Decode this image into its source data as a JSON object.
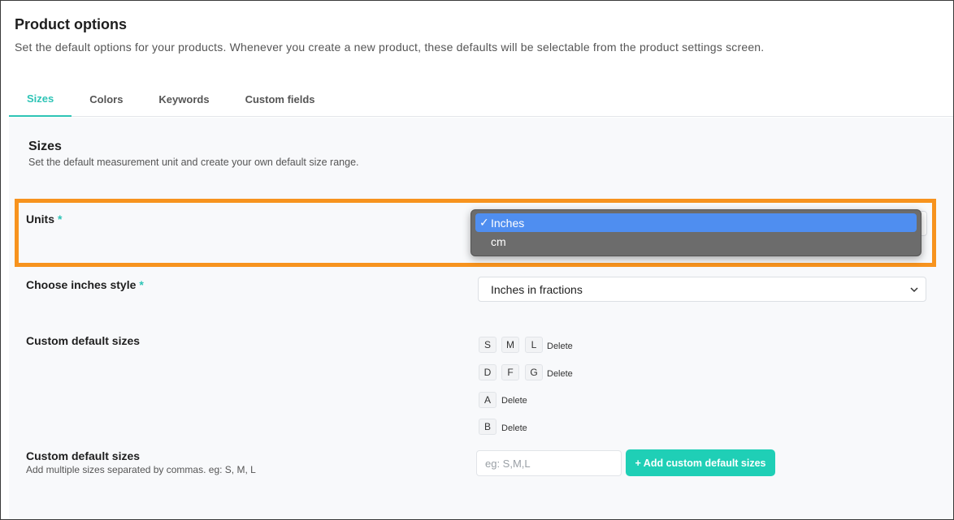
{
  "header": {
    "title": "Product options",
    "description": "Set the default options for your products. Whenever you create a new product, these defaults will be selectable from the product settings screen."
  },
  "tabs": [
    {
      "label": "Sizes",
      "active": true
    },
    {
      "label": "Colors",
      "active": false
    },
    {
      "label": "Keywords",
      "active": false
    },
    {
      "label": "Custom fields",
      "active": false
    }
  ],
  "sizes": {
    "title": "Sizes",
    "description": "Set the default measurement unit and create your own default size range.",
    "units": {
      "label": "Units",
      "required_mark": "*",
      "options": [
        {
          "label": "Inches",
          "selected": true,
          "check": "✓"
        },
        {
          "label": "cm",
          "selected": false,
          "check": ""
        }
      ]
    },
    "inches_style": {
      "label": "Choose inches style",
      "required_mark": "*",
      "value": "Inches in fractions"
    },
    "custom_sizes": {
      "label": "Custom default sizes",
      "delete_label": "Delete",
      "groups": [
        [
          "S",
          "M",
          "L"
        ],
        [
          "D",
          "F",
          "G"
        ],
        [
          "A"
        ],
        [
          "B"
        ]
      ]
    },
    "add_sizes": {
      "label": "Custom default sizes",
      "hint": "Add multiple sizes separated by commas. eg: S, M, L",
      "placeholder": "eg: S,M,L",
      "button_label": "+ Add custom default sizes"
    }
  },
  "colors": {
    "accent": "#2ec4b6",
    "button": "#1fcfb6",
    "highlight": "#f7931e",
    "dropdown_selected": "#4f8ef0"
  }
}
